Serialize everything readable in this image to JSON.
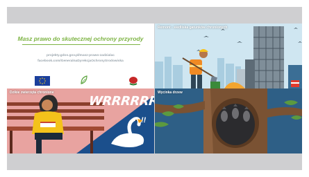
{
  "tiles": {
    "intro": {
      "heading": "Masz prawo do skutecznej ochrony przyrody",
      "link1": "projekty.gdos.gov.pl/masz-prawo-zadzialac",
      "link2": "facebook.com/GeneralnaDyrekcjaOchronySrodowiska",
      "logos": [
        "eu-flag-logo",
        "leaf-logo",
        "gdos-logo"
      ]
    },
    "renovation": {
      "title": "Remont - siedliska gatunków chronionych"
    },
    "animals": {
      "title": "Dzikie zwierzęta chronione",
      "exclaim": "WRRRRRR",
      "mark": "!!"
    },
    "tree": {
      "title": "Wycinka drzew"
    }
  },
  "colors": {
    "accent_green": "#7cb342",
    "sky": "#cfe6f1",
    "frame": "#cfcfd1",
    "night": "#2e5f86"
  }
}
